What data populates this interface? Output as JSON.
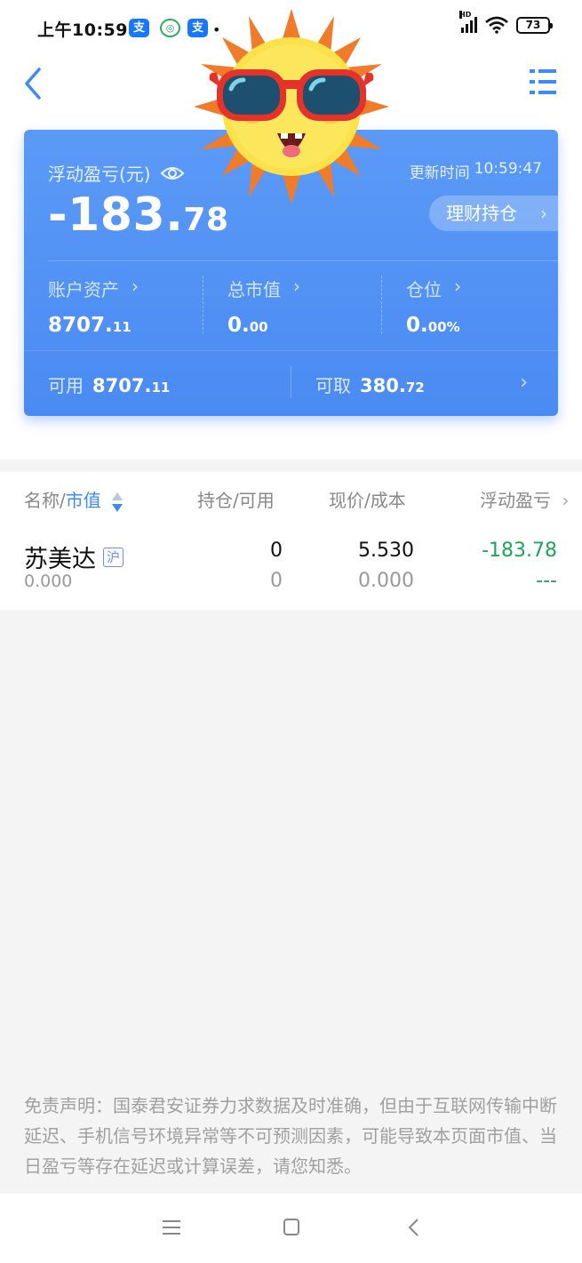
{
  "status_bar": {
    "time": "上午10:59",
    "app_icons": [
      "alipay-icon",
      "green-app-icon",
      "alipay-icon"
    ],
    "network": "HD",
    "battery": "73"
  },
  "nav": {
    "back_icon": "chevron-left-icon",
    "menu_icon": "list-menu-icon"
  },
  "card": {
    "pl_label": "浮动盈亏(元)",
    "update_label": "更新时间",
    "update_time": "10:59:47",
    "pl_int": "-183.",
    "pl_dec": "78",
    "wealth_button": "理财持仓",
    "stats": [
      {
        "label": "账户资产",
        "int": "8707.",
        "dec": "11"
      },
      {
        "label": "总市值",
        "int": "0.",
        "dec": "00"
      },
      {
        "label": "仓位",
        "int": "0.",
        "dec": "00%"
      }
    ],
    "available_label": "可用",
    "available_int": "8707.",
    "available_dec": "11",
    "withdrawable_label": "可取",
    "withdrawable_int": "380.",
    "withdrawable_dec": "72",
    "chevron": "›"
  },
  "table": {
    "headers": {
      "name_a": "名称/",
      "name_b": "市值",
      "position": "持仓/可用",
      "price": "现价/成本",
      "pl": "浮动盈亏"
    },
    "rows": [
      {
        "name": "苏美达",
        "market": "沪",
        "market_value": "0.000",
        "position": "0",
        "available": "0",
        "price": "5.530",
        "cost": "0.000",
        "pl": "-183.78",
        "pl_ratio": "---"
      }
    ]
  },
  "disclaimer": "免责声明：国泰君安证券力求数据及时准确，但由于互联网传输中断延迟、手机信号环境异常等不可预测因素，可能导致本页面市值、当日盈亏等存在延迟或计算误差，请您知悉。",
  "colors": {
    "accent": "#3d8af7",
    "card": "#4a8bf3",
    "profit_down": "#1ea45c"
  }
}
